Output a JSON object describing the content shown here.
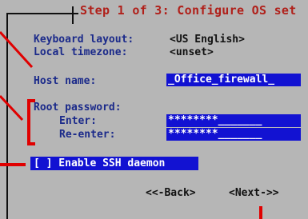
{
  "title": "Step 1 of 3: Configure OS set",
  "fields": {
    "keyboard_label": "Keyboard layout:",
    "keyboard_value": "<US English>",
    "timezone_label": "Local timezone:",
    "timezone_value": "<unset>",
    "hostname_label": "Host name:",
    "hostname_value": "_Office_firewall_",
    "root_password_label": "Root password:",
    "enter_label": "Enter:",
    "enter_value": "********_______",
    "reenter_label": "Re-enter:",
    "reenter_value": "********_______"
  },
  "ssh_option": "[ ] Enable SSH daemon",
  "buttons": {
    "back": "<<-Back>",
    "next": "<Next->>"
  },
  "colors": {
    "title": "#b0201a",
    "label": "#1b2a8a",
    "field_bg": "#1212d2",
    "annotation": "#e00000",
    "screen_bg": "#b6b6b6"
  }
}
